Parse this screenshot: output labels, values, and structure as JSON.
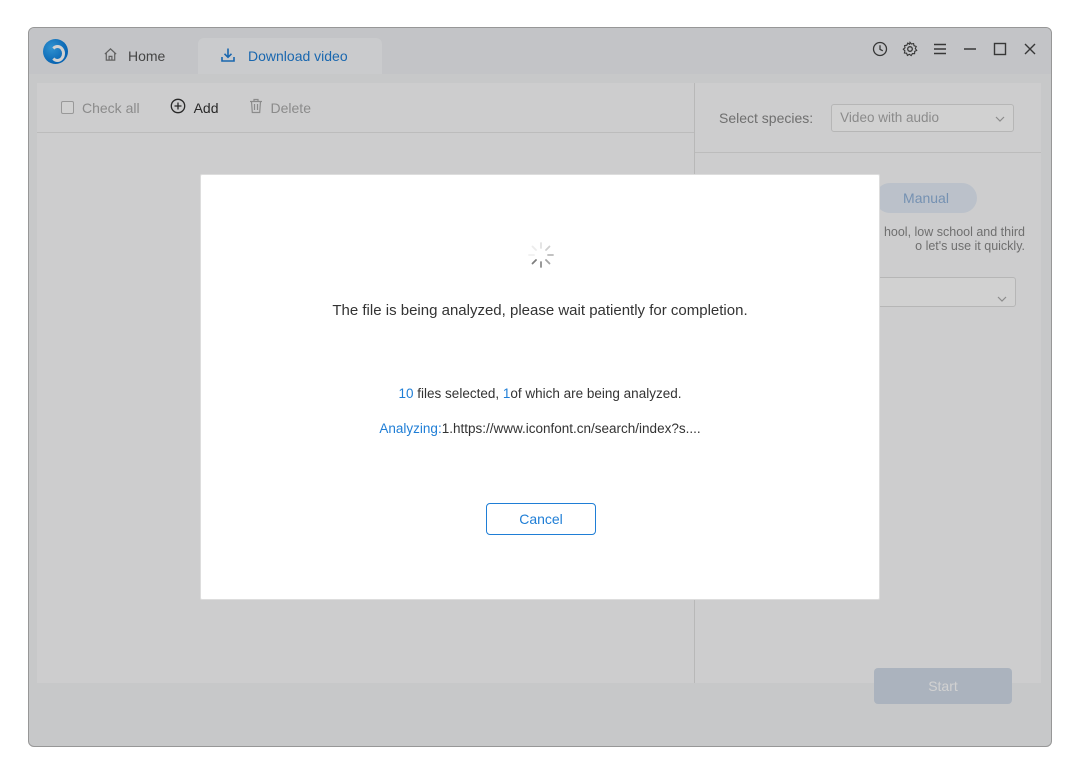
{
  "titlebar": {
    "tabs": [
      {
        "label": "Home",
        "icon": "home-icon"
      },
      {
        "label": "Download video",
        "icon": "download-icon"
      }
    ],
    "controls": [
      "history-icon",
      "gear-icon",
      "menu-icon",
      "minimize-icon",
      "maximize-icon",
      "close-icon"
    ]
  },
  "toolbar": {
    "check_all": "Check all",
    "add": "Add",
    "delete": "Delete"
  },
  "right_panel": {
    "species_label": "Select species:",
    "species_value": "Video with audio",
    "manual_button": "Manual",
    "desc_line1": "hool, low school and third",
    "desc_line2": "o let's use it quickly."
  },
  "start_button": "Start",
  "dialog": {
    "message": "The file is being analyzed, please wait patiently for completion.",
    "selected_count": "10",
    "selected_text": " files selected, ",
    "analyzing_count": "1",
    "analyzing_text": "of which are being analyzed.",
    "analyzing_label": "Analyzing:",
    "analyzing_url": "1.https://www.iconfont.cn/search/index?s....",
    "cancel_button": "Cancel"
  },
  "colors": {
    "accent": "#1f7ed6",
    "start_disabled": "#d1dbe8"
  }
}
